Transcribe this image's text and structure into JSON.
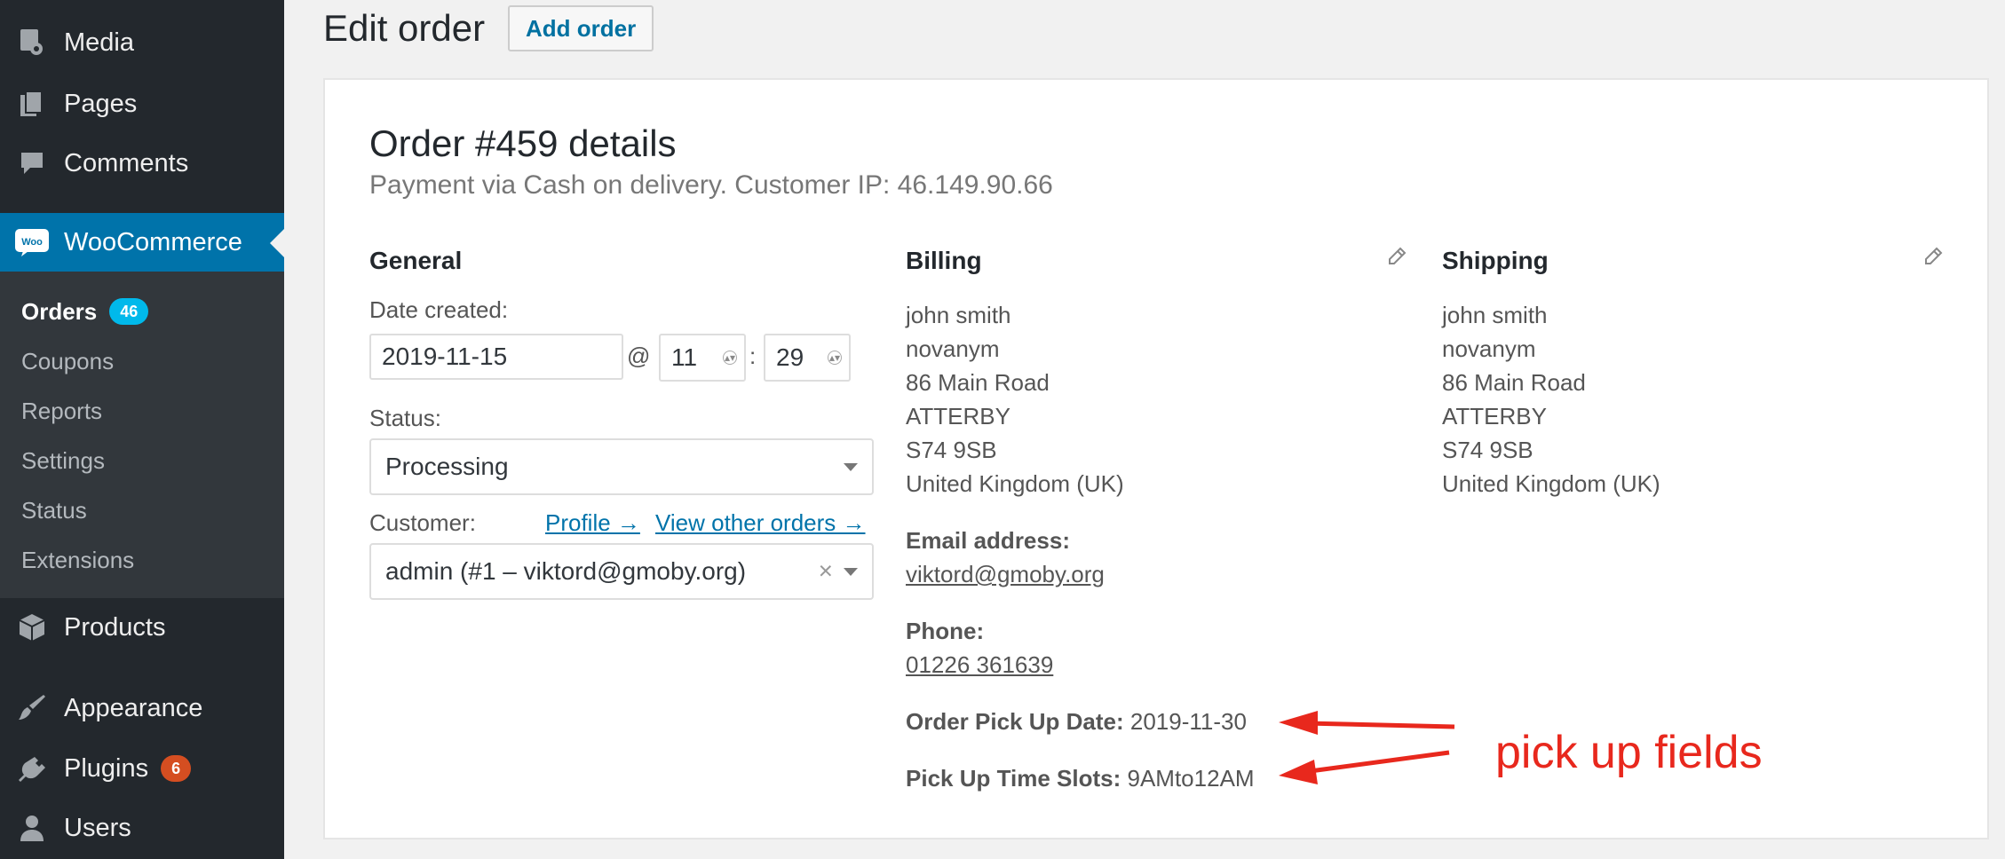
{
  "sidebar": {
    "top_items": [
      {
        "label": "Media",
        "icon": "media-icon"
      },
      {
        "label": "Pages",
        "icon": "pages-icon"
      },
      {
        "label": "Comments",
        "icon": "comments-icon"
      }
    ],
    "woocommerce": {
      "label": "WooCommerce",
      "icon": "woocommerce-icon",
      "icon_text": "Woo"
    },
    "submenu": [
      {
        "label": "Orders",
        "badge": "46"
      },
      {
        "label": "Coupons"
      },
      {
        "label": "Reports"
      },
      {
        "label": "Settings"
      },
      {
        "label": "Status"
      },
      {
        "label": "Extensions"
      }
    ],
    "bottom_items": [
      {
        "label": "Products",
        "icon": "products-icon"
      },
      {
        "label": "Appearance",
        "icon": "appearance-icon"
      },
      {
        "label": "Plugins",
        "icon": "plugins-icon",
        "badge": "6"
      },
      {
        "label": "Users",
        "icon": "users-icon"
      }
    ]
  },
  "header": {
    "title": "Edit order",
    "add_button": "Add order"
  },
  "order": {
    "heading": "Order #459 details",
    "meta": "Payment via Cash on delivery. Customer IP: 46.149.90.66"
  },
  "general": {
    "title": "General",
    "date_label": "Date created:",
    "date_value": "2019-11-15",
    "at_sign": "@",
    "hour": "11",
    "colon": ":",
    "minute": "29",
    "status_label": "Status:",
    "status_value": "Processing",
    "customer_label": "Customer:",
    "profile_link": "Profile →",
    "other_orders_link": "View other orders →",
    "customer_value": "admin (#1 – viktord@gmoby.org)",
    "clear_glyph": "×"
  },
  "billing": {
    "title": "Billing",
    "address": [
      "john smith",
      "novanym",
      "86 Main Road",
      "ATTERBY",
      "S74 9SB",
      "United Kingdom (UK)"
    ],
    "email_label": "Email address:",
    "email": "viktord@gmoby.org",
    "phone_label": "Phone:",
    "phone": "01226 361639",
    "pickup_date_label": "Order Pick Up Date:",
    "pickup_date": "2019-11-30",
    "pickup_slot_label": "Pick Up Time Slots:",
    "pickup_slot": "9AMto12AM"
  },
  "shipping": {
    "title": "Shipping",
    "address": [
      "john smith",
      "novanym",
      "86 Main Road",
      "ATTERBY",
      "S74 9SB",
      "United Kingdom (UK)"
    ]
  },
  "annotation": {
    "text": "pick up fields",
    "color": "#e8281d"
  },
  "colors": {
    "sidebar_bg": "#23282d",
    "submenu_bg": "#32373c",
    "active_menu": "#0073aa",
    "orders_badge": "#00b9eb",
    "plugins_badge": "#d54e21",
    "link": "#0073aa"
  }
}
